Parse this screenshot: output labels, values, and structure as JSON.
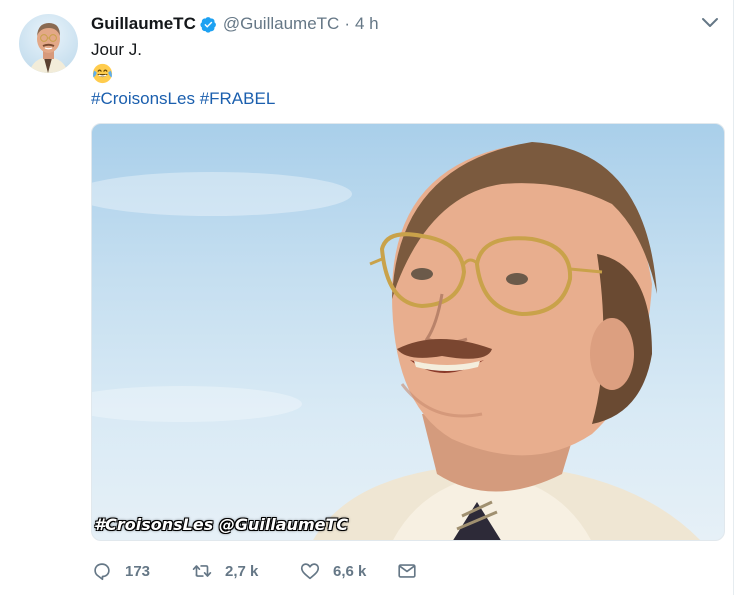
{
  "tweet": {
    "author_name": "GuillaumeTC",
    "handle": "@GuillaumeTC",
    "separator": "·",
    "time": "4 h",
    "text_line1": "Jour J.",
    "emoji_icon": "face-with-tears-of-joy",
    "hashtags": [
      "#CroisonsLes",
      "#FRABEL"
    ],
    "media": {
      "watermark": "#CroisonsLes @GuillaumeTC"
    },
    "actions": {
      "reply_count": "173",
      "retweet_count": "2,7 k",
      "like_count": "6,6 k"
    }
  },
  "colors": {
    "link": "#1b5fae",
    "verified": "#1da1f2",
    "muted": "#657786"
  }
}
